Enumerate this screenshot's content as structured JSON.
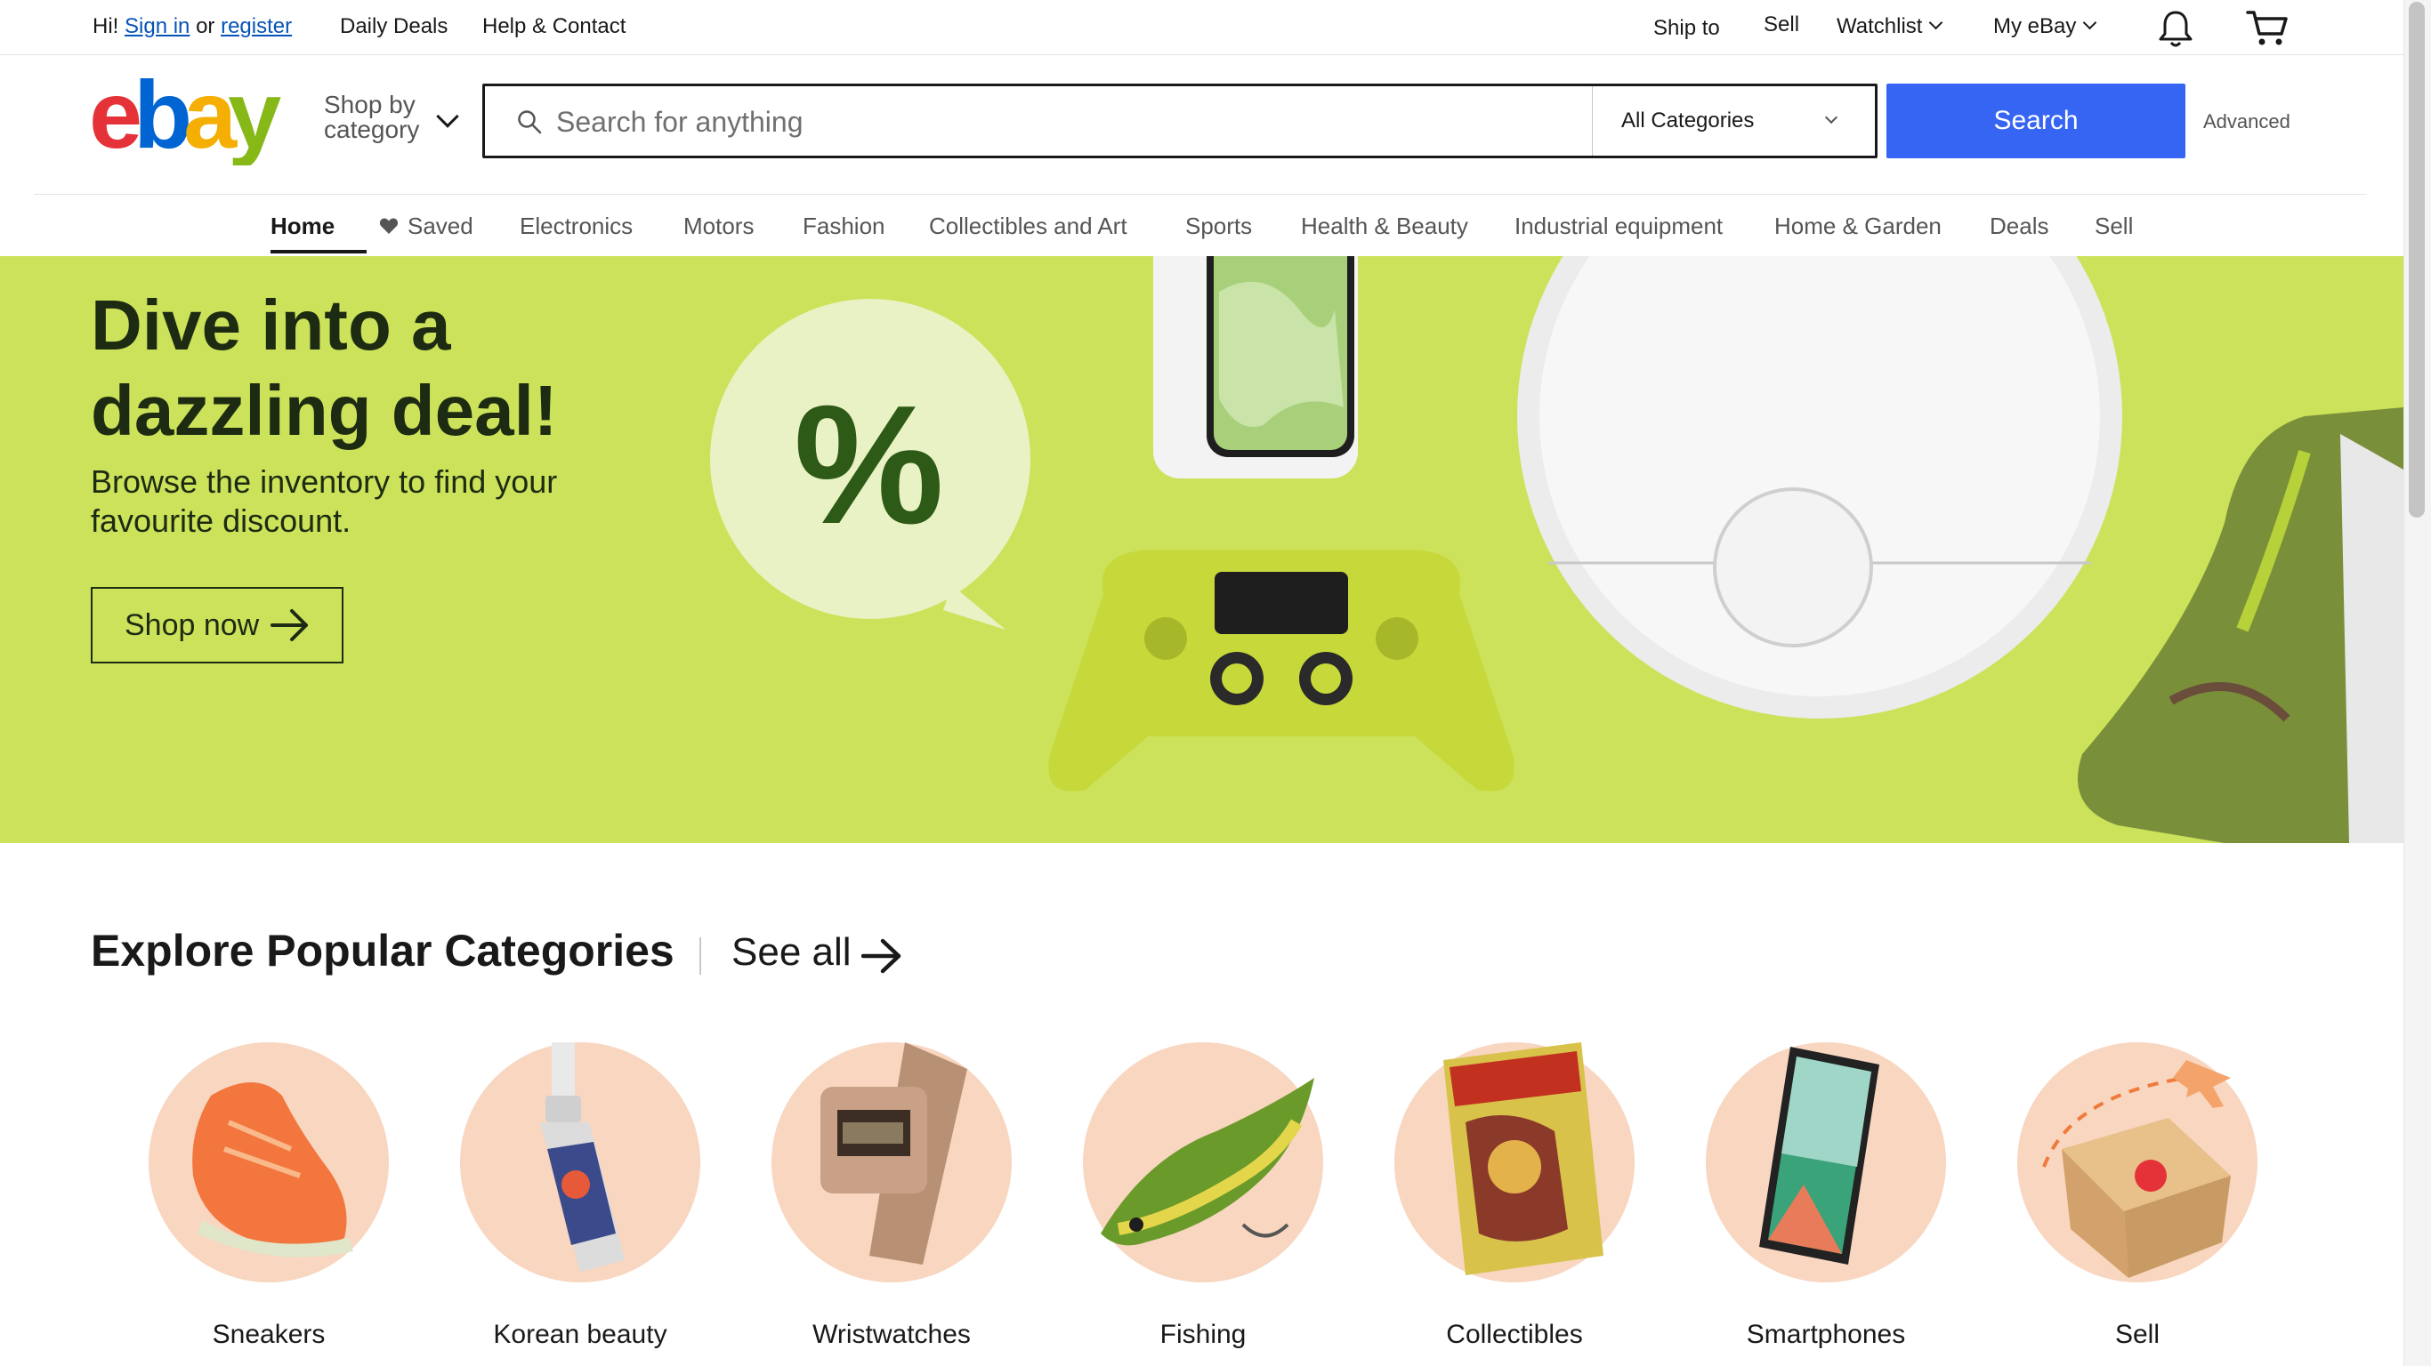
{
  "topbar": {
    "greeting": "Hi!",
    "sign_in": "Sign in",
    "or": "or",
    "register": "register",
    "daily_deals": "Daily Deals",
    "help_contact": "Help & Contact",
    "ship_to": "Ship to",
    "sell": "Sell",
    "watchlist": "Watchlist",
    "my_ebay": "My eBay",
    "bell_icon": "bell-icon",
    "cart_icon": "cart-icon"
  },
  "header": {
    "logo": "ebay",
    "shop_by": "Shop by",
    "category": "category",
    "search_placeholder": "Search for anything",
    "category_select": "All Categories",
    "search_button": "Search",
    "advanced": "Advanced"
  },
  "nav": {
    "items": [
      "Home",
      "Saved",
      "Electronics",
      "Motors",
      "Fashion",
      "Collectibles and Art",
      "Sports",
      "Health & Beauty",
      "Industrial equipment",
      "Home & Garden",
      "Deals",
      "Sell"
    ],
    "active": "Home"
  },
  "hero": {
    "title": "Dive into a dazzling deal!",
    "subtitle": "Browse the inventory to find your favourite discount.",
    "button": "Shop now",
    "background": "#cce25a"
  },
  "explore": {
    "title": "Explore Popular Categories",
    "see_all": "See all",
    "categories": [
      "Sneakers",
      "Korean beauty",
      "Wristwatches",
      "Fishing",
      "Collectibles",
      "Smartphones",
      "Sell"
    ]
  },
  "colors": {
    "accent": "#3665f3",
    "link": "#0654ba",
    "logo_red": "#e53238",
    "logo_blue": "#0064d2",
    "logo_yellow": "#f5af02",
    "logo_green": "#86b817"
  }
}
